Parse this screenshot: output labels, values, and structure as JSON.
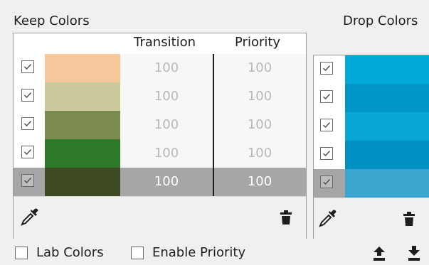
{
  "keep_section": {
    "title": "Keep Colors",
    "columns": {
      "transition": "Transition",
      "priority": "Priority"
    },
    "rows": [
      {
        "checked": true,
        "color": "#f5c79a",
        "transition": "100",
        "priority": "100",
        "selected": false
      },
      {
        "checked": true,
        "color": "#ccc99d",
        "transition": "100",
        "priority": "100",
        "selected": false
      },
      {
        "checked": true,
        "color": "#7d8c51",
        "transition": "100",
        "priority": "100",
        "selected": false
      },
      {
        "checked": true,
        "color": "#2e7a2c",
        "transition": "100",
        "priority": "100",
        "selected": false
      },
      {
        "checked": true,
        "color": "#3d4a24",
        "transition": "100",
        "priority": "100",
        "selected": true
      }
    ],
    "tools": {
      "picker_icon": "eyedropper-icon",
      "delete_icon": "trash-icon"
    }
  },
  "drop_section": {
    "title": "Drop Colors",
    "rows": [
      {
        "checked": true,
        "color": "#00a9d8",
        "selected": false
      },
      {
        "checked": true,
        "color": "#0096c6",
        "selected": false
      },
      {
        "checked": true,
        "color": "#08a6d4",
        "selected": false
      },
      {
        "checked": true,
        "color": "#0090c2",
        "selected": false
      },
      {
        "checked": true,
        "color": "#3ba5cf",
        "selected": true
      }
    ],
    "tools": {
      "picker_icon": "eyedropper-icon",
      "delete_icon": "trash-icon"
    }
  },
  "options": {
    "lab_colors": {
      "label": "Lab Colors",
      "checked": false
    },
    "enable_priority": {
      "label": "Enable Priority",
      "checked": false
    }
  },
  "actions": {
    "import_icon": "upload-icon",
    "export_icon": "download-icon"
  }
}
